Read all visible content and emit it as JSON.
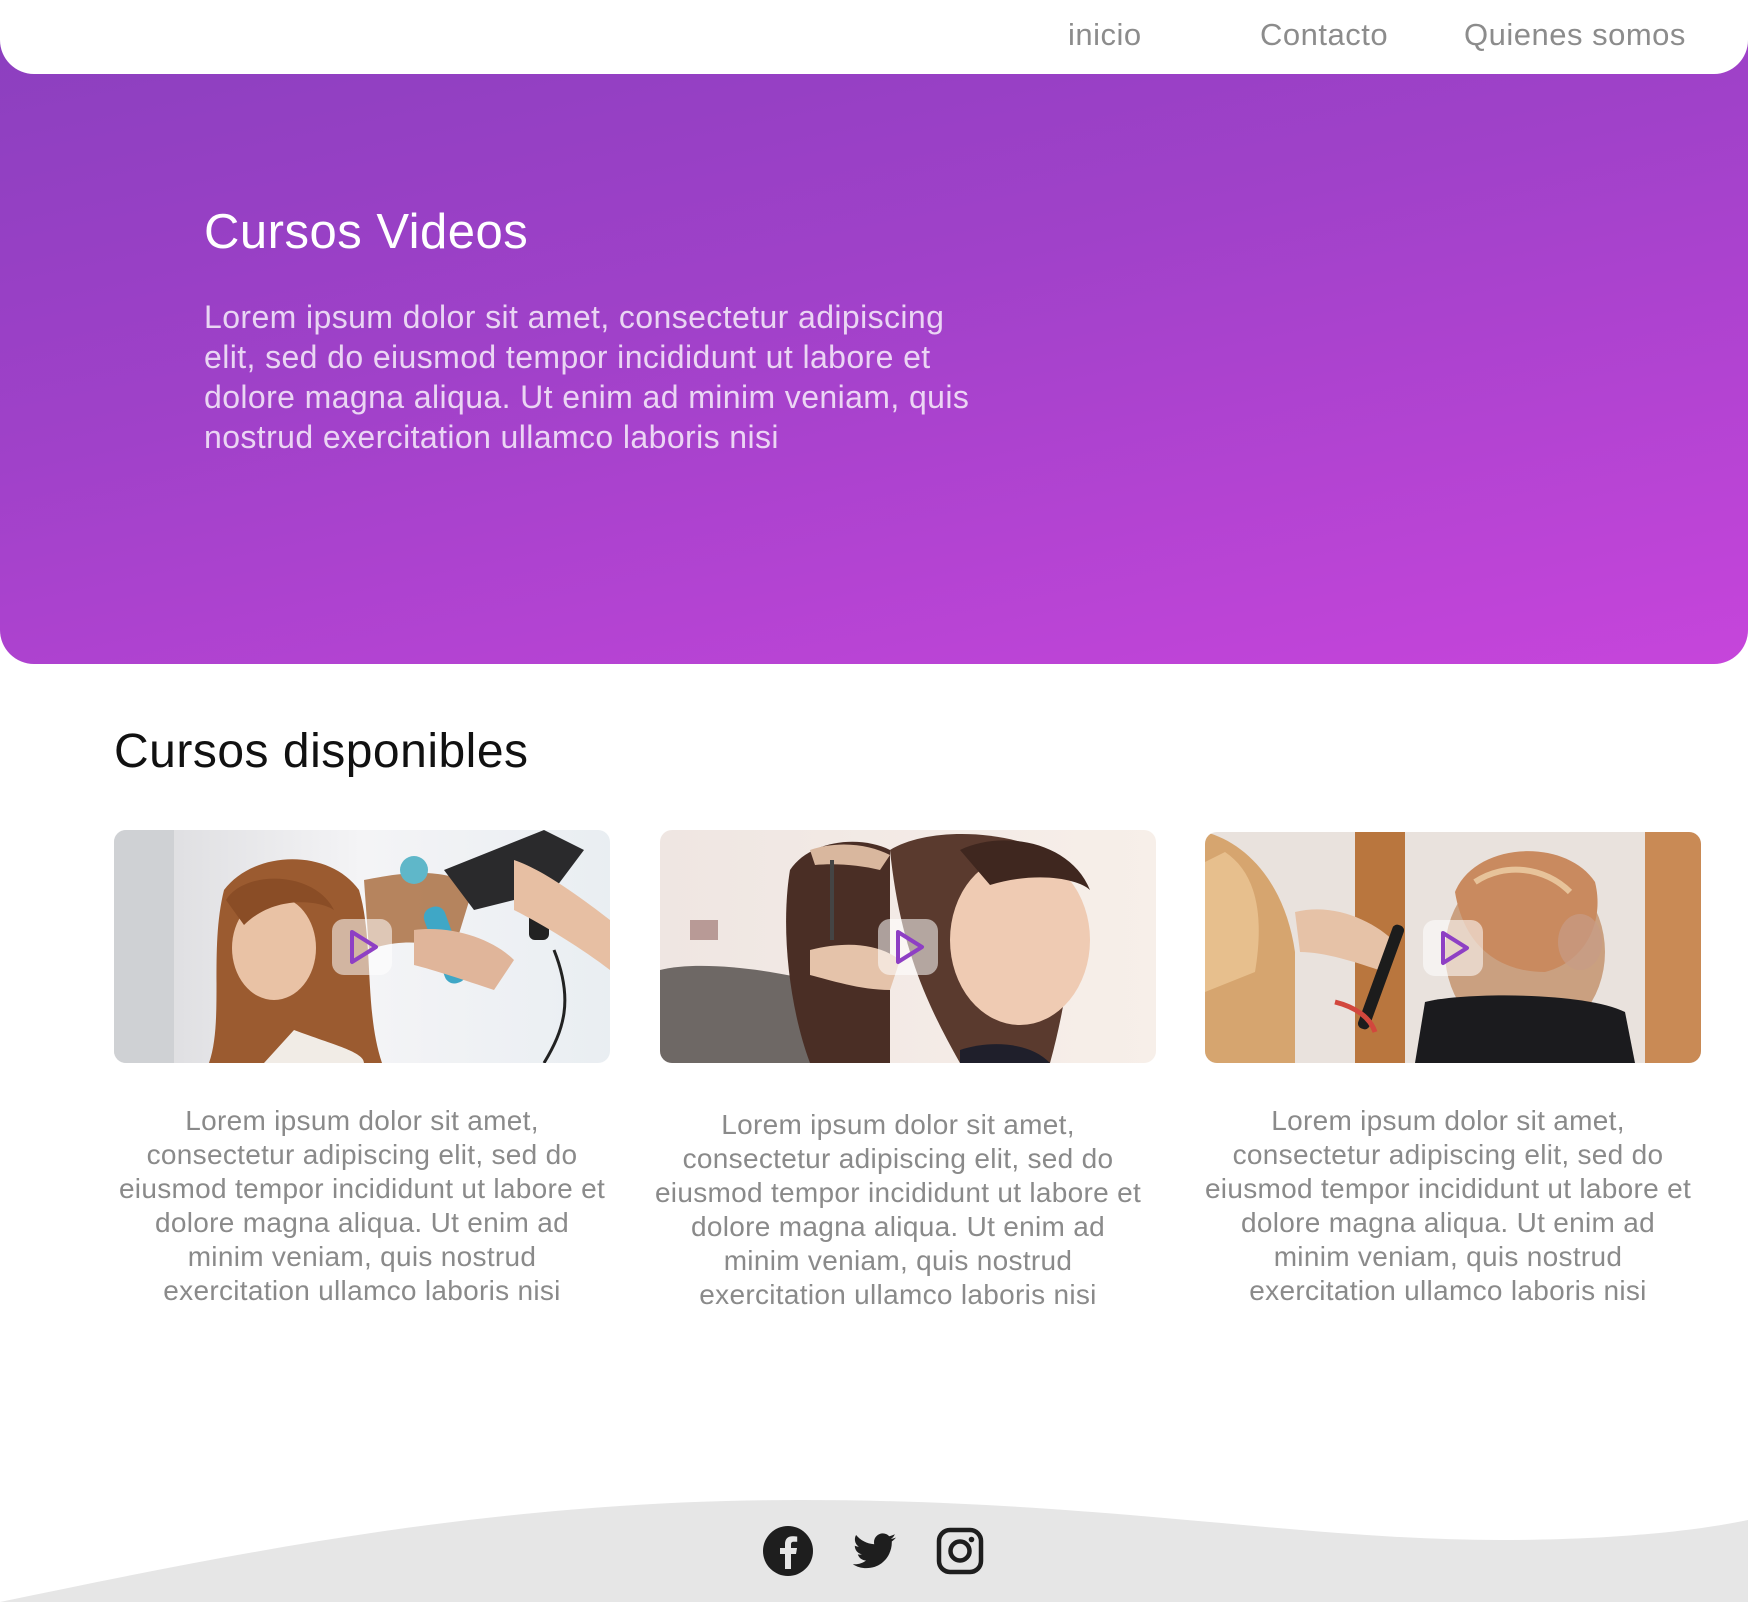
{
  "nav": {
    "links": [
      "inicio",
      "Contacto",
      "Quienes somos"
    ]
  },
  "hero": {
    "title": "Cursos Videos",
    "text": "Lorem ipsum dolor sit amet, consectetur adipiscing elit, sed do eiusmod tempor incididunt ut labore et dolore magna aliqua. Ut enim ad minim veniam, quis nostrud exercitation ullamco laboris nisi"
  },
  "courses": {
    "title": "Cursos disponibles",
    "items": [
      {
        "text": "Lorem ipsum dolor sit amet, consectetur adipiscing elit, sed do eiusmod tempor incididunt ut labore et dolore magna aliqua. Ut enim ad minim veniam, quis nostrud exercitation ullamco laboris nisi",
        "icon": "play-icon"
      },
      {
        "text": "Lorem ipsum dolor sit amet, consectetur adipiscing elit, sed do eiusmod tempor incididunt ut labore et dolore magna aliqua. Ut enim ad minim veniam, quis nostrud exercitation ullamco laboris nisi",
        "icon": "play-icon"
      },
      {
        "text": "Lorem ipsum dolor sit amet, consectetur adipiscing elit, sed do eiusmod tempor incididunt ut labore et dolore magna aliqua. Ut enim ad minim veniam, quis nostrud exercitation ullamco laboris nisi",
        "icon": "play-icon"
      }
    ]
  },
  "footer": {
    "social_icons": [
      "facebook-icon",
      "twitter-icon",
      "instagram-icon"
    ]
  },
  "colors": {
    "gradient_start": "#8a3fbe",
    "gradient_end": "#c645db",
    "accent": "#8e3fc4",
    "footer_bg": "#e6e6e6"
  }
}
